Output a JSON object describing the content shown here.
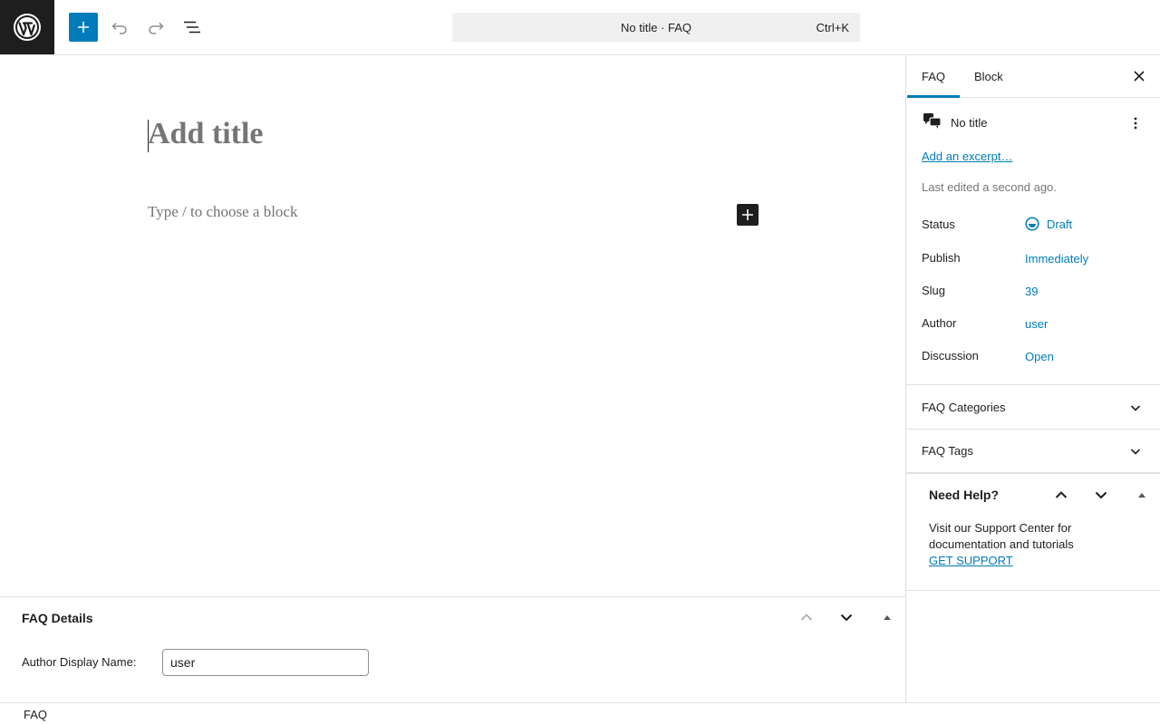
{
  "topbar": {
    "document_title": "No title · FAQ",
    "shortcut": "Ctrl+K"
  },
  "editor": {
    "title_placeholder": "Add title",
    "block_placeholder": "Type / to choose a block"
  },
  "metabox": {
    "title": "FAQ Details",
    "author_label": "Author Display Name:",
    "author_value": "user"
  },
  "footer": {
    "breadcrumb": "FAQ"
  },
  "sidebar": {
    "tabs": [
      {
        "label": "FAQ",
        "active": true
      },
      {
        "label": "Block",
        "active": false
      }
    ],
    "post_title": "No title",
    "excerpt_link": "Add an excerpt…",
    "last_edited": "Last edited a second ago.",
    "rows": [
      {
        "label": "Status",
        "value": "Draft"
      },
      {
        "label": "Publish",
        "value": "Immediately"
      },
      {
        "label": "Slug",
        "value": "39"
      },
      {
        "label": "Author",
        "value": "user"
      },
      {
        "label": "Discussion",
        "value": "Open"
      }
    ],
    "panels": [
      {
        "title": "FAQ Categories"
      },
      {
        "title": "FAQ Tags"
      }
    ],
    "help": {
      "title": "Need Help?",
      "text": "Visit our Support Center for documentation and tutorials",
      "link": "GET SUPPORT"
    }
  },
  "colors": {
    "accent": "#007cba",
    "dark": "#1e1e1e",
    "muted": "#757575"
  }
}
